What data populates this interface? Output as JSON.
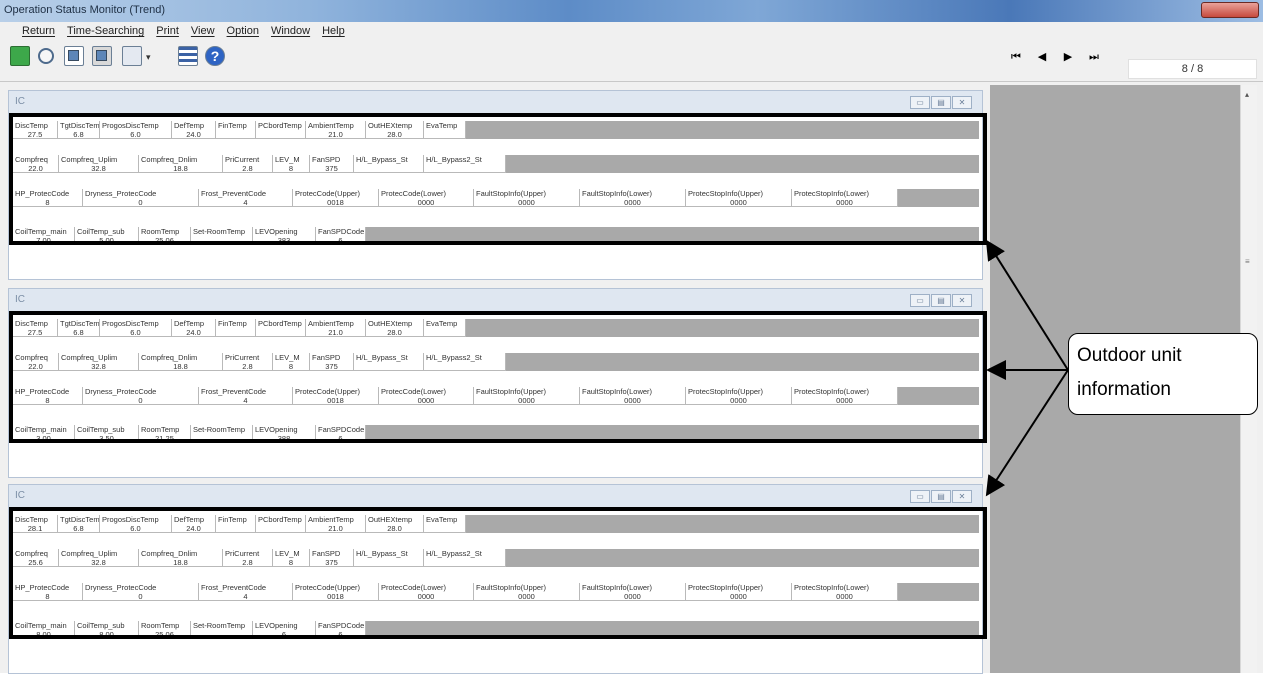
{
  "window": {
    "title": "Operation Status Monitor (Trend)"
  },
  "menu": [
    "Return",
    "Time-Searching",
    "Print",
    "View",
    "Option",
    "Window",
    "Help"
  ],
  "toolbar_icons": [
    "trend-icon",
    "search-icon",
    "copy-icon",
    "paste-icon",
    "image-icon",
    "list-icon",
    "help-icon"
  ],
  "help_glyph": "?",
  "nav": {
    "page": "8 / 8"
  },
  "windows": [
    {
      "title": "IC",
      "rows": [
        {
          "cells": [
            [
              "DiscTemp",
              "27.5"
            ],
            [
              "TgtDiscTemp",
              "6.8"
            ],
            [
              "ProgosDiscTemp",
              "6.0"
            ],
            [
              "DefTemp",
              "24.0"
            ],
            [
              "FinTemp",
              ""
            ],
            [
              "PCbordTemp",
              ""
            ],
            [
              "AmbientTemp",
              "21.0"
            ],
            [
              "OutHEXtemp",
              "28.0"
            ],
            [
              "EvaTemp",
              ""
            ]
          ]
        },
        {
          "cells": [
            [
              "Compfreq",
              "22.0"
            ],
            [
              "Compfreq_Uplim",
              "32.8"
            ],
            [
              "Compfreq_Dnlim",
              "18.8"
            ],
            [
              "PriCurrent",
              "2.8"
            ],
            [
              "LEV_M",
              "8"
            ],
            [
              "FanSPD",
              "375"
            ],
            [
              "H/L_Bypass_St",
              ""
            ],
            [
              "H/L_Bypass2_St",
              ""
            ]
          ]
        },
        {
          "cells": [
            [
              "HP_ProtecCode",
              "8"
            ],
            [
              "Dryness_ProtecCode",
              "0"
            ],
            [
              "Frost_PreventCode",
              "4"
            ],
            [
              "ProtecCode(Upper)",
              "0018"
            ],
            [
              "ProtecCode(Lower)",
              "0000"
            ],
            [
              "FaultStopInfo(Upper)",
              "0000"
            ],
            [
              "FaultStopInfo(Lower)",
              "0000"
            ],
            [
              "ProtecStopInfo(Upper)",
              "0000"
            ],
            [
              "ProtecStopInfo(Lower)",
              "0000"
            ]
          ]
        },
        {
          "cells": [
            [
              "CoilTemp_main",
              "7.00"
            ],
            [
              "CoilTemp_sub",
              "5.00"
            ],
            [
              "RoomTemp",
              "25.06"
            ],
            [
              "Set-RoomTemp",
              ""
            ],
            [
              "LEVOpening",
              "383"
            ],
            [
              "FanSPDCode",
              "6"
            ]
          ]
        }
      ]
    },
    {
      "title": "IC",
      "rows": [
        {
          "cells": [
            [
              "DiscTemp",
              "27.5"
            ],
            [
              "TgtDiscTemp",
              "6.8"
            ],
            [
              "ProgosDiscTemp",
              "6.0"
            ],
            [
              "DefTemp",
              "24.0"
            ],
            [
              "FinTemp",
              ""
            ],
            [
              "PCbordTemp",
              ""
            ],
            [
              "AmbientTemp",
              "21.0"
            ],
            [
              "OutHEXtemp",
              "28.0"
            ],
            [
              "EvaTemp",
              ""
            ]
          ]
        },
        {
          "cells": [
            [
              "Compfreq",
              "22.0"
            ],
            [
              "Compfreq_Uplim",
              "32.8"
            ],
            [
              "Compfreq_Dnlim",
              "18.8"
            ],
            [
              "PriCurrent",
              "2.8"
            ],
            [
              "LEV_M",
              "8"
            ],
            [
              "FanSPD",
              "375"
            ],
            [
              "H/L_Bypass_St",
              ""
            ],
            [
              "H/L_Bypass2_St",
              ""
            ]
          ]
        },
        {
          "cells": [
            [
              "HP_ProtecCode",
              "8"
            ],
            [
              "Dryness_ProtecCode",
              "0"
            ],
            [
              "Frost_PreventCode",
              "4"
            ],
            [
              "ProtecCode(Upper)",
              "0018"
            ],
            [
              "ProtecCode(Lower)",
              "0000"
            ],
            [
              "FaultStopInfo(Upper)",
              "0000"
            ],
            [
              "FaultStopInfo(Lower)",
              "0000"
            ],
            [
              "ProtecStopInfo(Upper)",
              "0000"
            ],
            [
              "ProtecStopInfo(Lower)",
              "0000"
            ]
          ]
        },
        {
          "cells": [
            [
              "CoilTemp_main",
              "3.00"
            ],
            [
              "CoilTemp_sub",
              "3.50"
            ],
            [
              "RoomTemp",
              "21.25"
            ],
            [
              "Set-RoomTemp",
              ""
            ],
            [
              "LEVOpening",
              "388"
            ],
            [
              "FanSPDCode",
              "6"
            ]
          ]
        }
      ]
    },
    {
      "title": "IC",
      "rows": [
        {
          "cells": [
            [
              "DiscTemp",
              "28.1"
            ],
            [
              "TgtDiscTemp",
              "6.8"
            ],
            [
              "ProgosDiscTemp",
              "6.0"
            ],
            [
              "DefTemp",
              "24.0"
            ],
            [
              "FinTemp",
              ""
            ],
            [
              "PCbordTemp",
              ""
            ],
            [
              "AmbientTemp",
              "21.0"
            ],
            [
              "OutHEXtemp",
              "28.0"
            ],
            [
              "EvaTemp",
              ""
            ]
          ]
        },
        {
          "cells": [
            [
              "Compfreq",
              "25.6"
            ],
            [
              "Compfreq_Uplim",
              "32.8"
            ],
            [
              "Compfreq_Dnlim",
              "18.8"
            ],
            [
              "PriCurrent",
              "2.8"
            ],
            [
              "LEV_M",
              "8"
            ],
            [
              "FanSPD",
              "375"
            ],
            [
              "H/L_Bypass_St",
              ""
            ],
            [
              "H/L_Bypass2_St",
              ""
            ]
          ]
        },
        {
          "cells": [
            [
              "HP_ProtecCode",
              "8"
            ],
            [
              "Dryness_ProtecCode",
              "0"
            ],
            [
              "Frost_PreventCode",
              "4"
            ],
            [
              "ProtecCode(Upper)",
              "0018"
            ],
            [
              "ProtecCode(Lower)",
              "0000"
            ],
            [
              "FaultStopInfo(Upper)",
              "0000"
            ],
            [
              "FaultStopInfo(Lower)",
              "0000"
            ],
            [
              "ProtecStopInfo(Upper)",
              "0000"
            ],
            [
              "ProtecStopInfo(Lower)",
              "0000"
            ]
          ]
        },
        {
          "cells": [
            [
              "CoilTemp_main",
              "8.00"
            ],
            [
              "CoilTemp_sub",
              "8.00"
            ],
            [
              "RoomTemp",
              "25.06"
            ],
            [
              "Set-RoomTemp",
              ""
            ],
            [
              "LEVOpening",
              "6"
            ],
            [
              "FanSPDCode",
              "6"
            ]
          ]
        }
      ]
    }
  ],
  "callout": {
    "line1": "Outdoor unit",
    "line2": "information"
  }
}
